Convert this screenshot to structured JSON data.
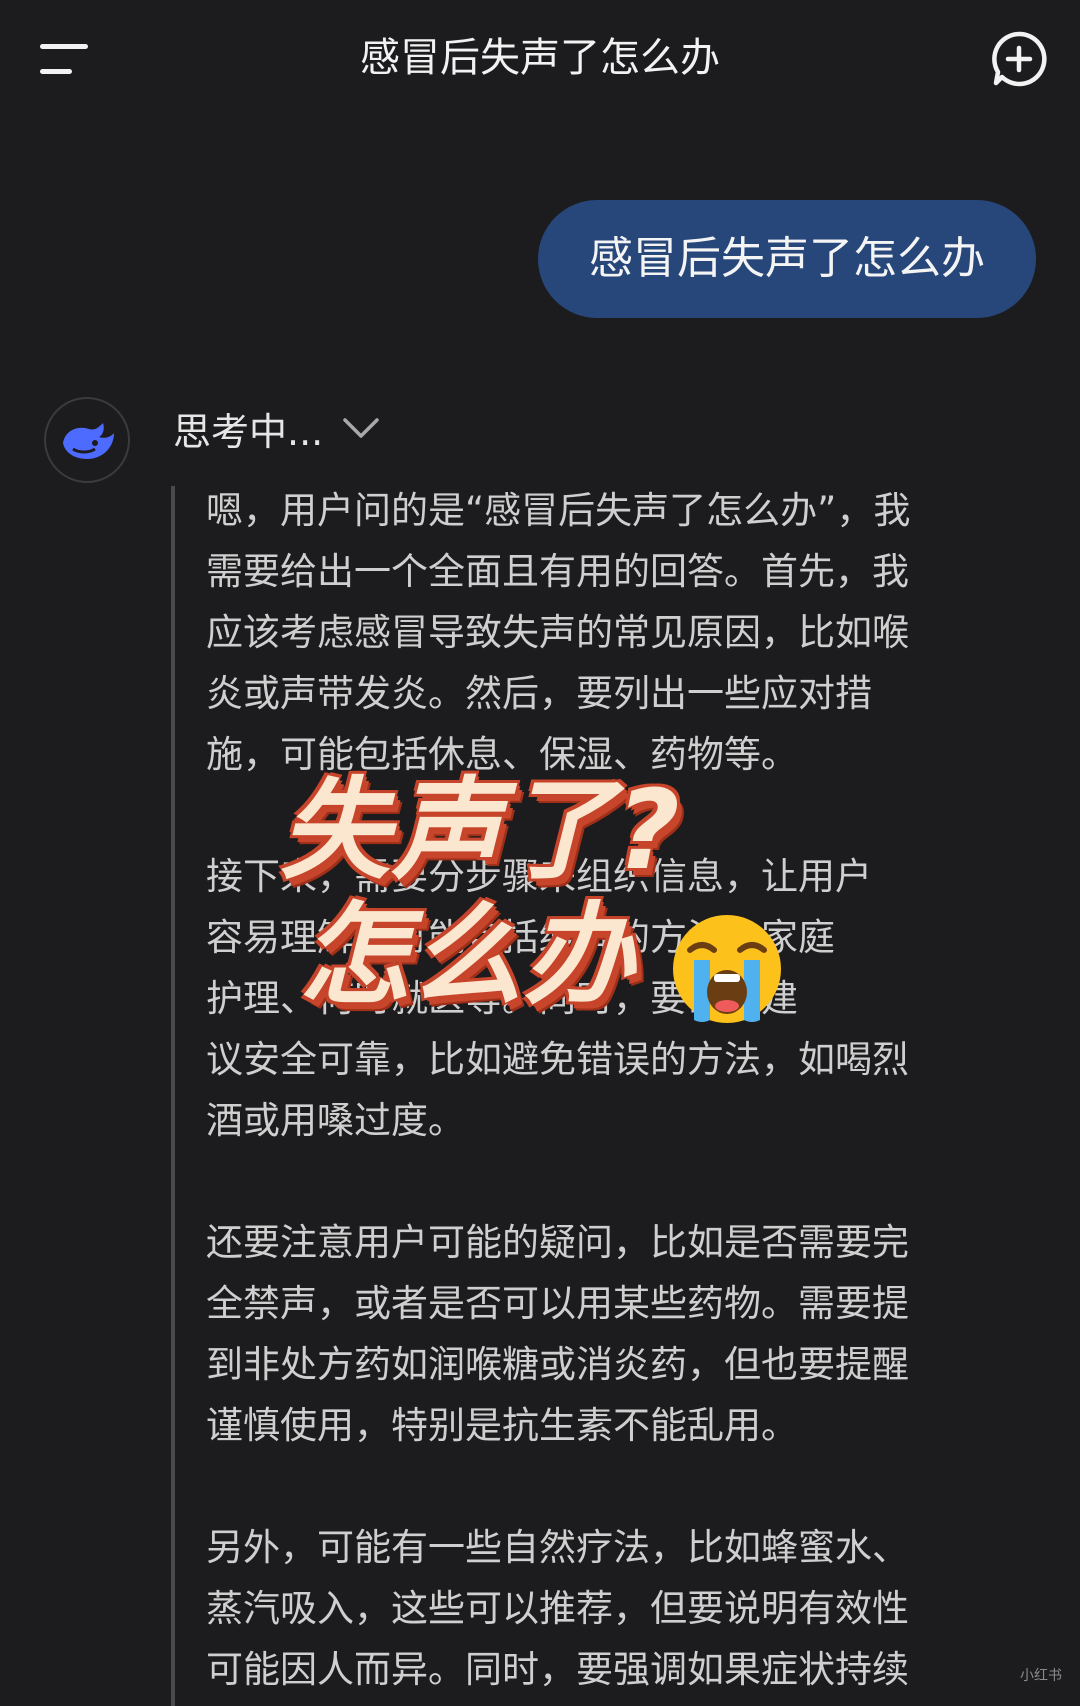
{
  "header": {
    "title": "感冒后失声了怎么办"
  },
  "user_message": "感冒后失声了怎么办",
  "thinking": {
    "label": "思考中...",
    "paragraphs": [
      [
        "嗯，用户问的是“感冒后失声了怎么办”，我",
        "需要给出一个全面且有用的回答。首先，我",
        "应该考虑感冒导致失声的常见原因，比如喉",
        "炎或声带发炎。然后，要列出一些应对措",
        "施，可能包括休息、保湿、药物等。"
      ],
      [
        "接下来，需要分步骤来组织信息，让用户",
        "容易理解。可能包括缓解的方法、家庭",
        "护理、何时就医等。同时，要确保建",
        "议安全可靠，比如避免错误的方法，如喝烈",
        "酒或用嗓过度。"
      ],
      [
        "还要注意用户可能的疑问，比如是否需要完",
        "全禁声，或者是否可以用某些药物。需要提",
        "到非处方药如润喉糖或消炎药，但也要提醒",
        "谨慎使用，特别是抗生素不能乱用。"
      ],
      [
        "另外，可能有一些自然疗法，比如蜂蜜水、",
        "蒸汽吸入，这些可以推荐，但要说明有效性",
        "可能因人而异。同时，要强调如果症状持续"
      ]
    ]
  },
  "overlay": {
    "line1": "失声了?",
    "line2": "怎么办",
    "emoji": "loudly-crying-face"
  },
  "watermark": "小红书",
  "colors": {
    "background": "#1c1c1e",
    "user_bubble": "#27467a",
    "overlay_text": "#fbe6cf",
    "overlay_outline": "#c7452b",
    "logo": "#4d6bfe"
  }
}
